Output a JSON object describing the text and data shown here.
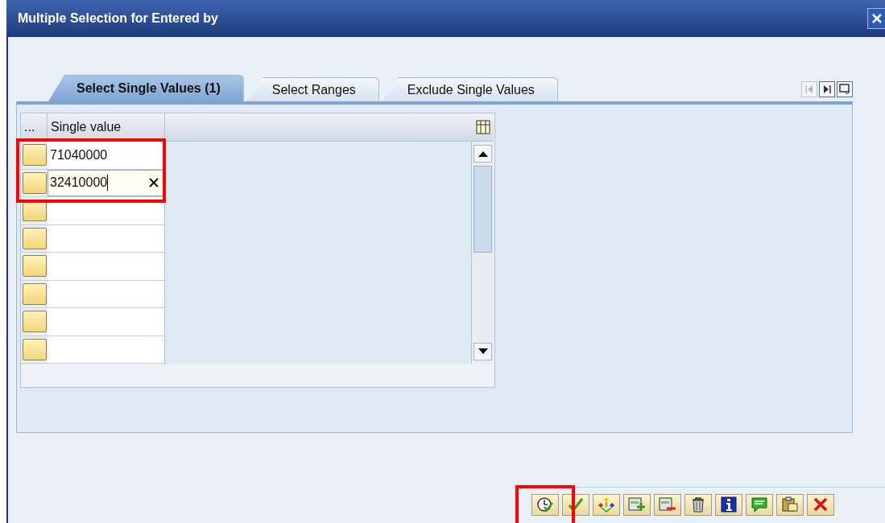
{
  "window": {
    "title": "Multiple Selection for Entered by"
  },
  "tabs": [
    {
      "label": "Select Single Values (1)",
      "selected": true
    },
    {
      "label": "Select Ranges",
      "selected": false
    },
    {
      "label": "Exclude Single Values",
      "selected": false
    }
  ],
  "tab_nav": [
    {
      "kind": "first",
      "disabled": true
    },
    {
      "kind": "last",
      "disabled": false
    },
    {
      "kind": "list",
      "disabled": false
    }
  ],
  "table": {
    "columns": [
      "...",
      "Single value"
    ],
    "rows": [
      {
        "value": "71040000",
        "focused": false
      },
      {
        "value": "32410000",
        "focused": true
      },
      {
        "focused": false
      },
      {
        "focused": false
      },
      {
        "focused": false
      },
      {
        "focused": false
      },
      {
        "focused": false
      },
      {
        "focused": false
      }
    ]
  },
  "toolbar": [
    {
      "kind": "execute"
    },
    {
      "kind": "check"
    },
    {
      "kind": "hierarchy"
    },
    {
      "kind": "add"
    },
    {
      "kind": "remove"
    },
    {
      "kind": "trash"
    },
    {
      "kind": "info"
    },
    {
      "kind": "comment"
    },
    {
      "kind": "clipboard"
    },
    {
      "kind": "cancel"
    }
  ]
}
